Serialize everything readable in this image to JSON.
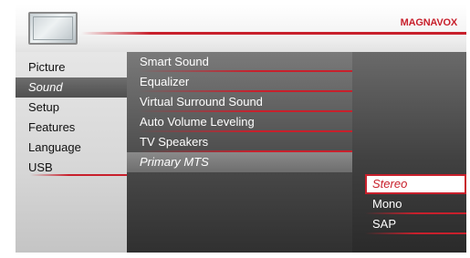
{
  "header": {
    "brand": "MAGNAVOX",
    "icon": "tv-icon"
  },
  "menu": {
    "main_items": [
      {
        "label": "Picture",
        "selected": false
      },
      {
        "label": "Sound",
        "selected": true
      },
      {
        "label": "Setup",
        "selected": false
      },
      {
        "label": "Features",
        "selected": false
      },
      {
        "label": "Language",
        "selected": false
      },
      {
        "label": "USB",
        "selected": false
      }
    ],
    "sound_items": [
      {
        "label": "Smart Sound",
        "selected": false
      },
      {
        "label": "Equalizer",
        "selected": false
      },
      {
        "label": "Virtual Surround Sound",
        "selected": false
      },
      {
        "label": "Auto Volume Leveling",
        "selected": false
      },
      {
        "label": "TV Speakers",
        "selected": false
      },
      {
        "label": "Primary MTS",
        "selected": true
      }
    ],
    "mts_options": [
      {
        "label": "Stereo",
        "selected": true
      },
      {
        "label": "Mono",
        "selected": false
      },
      {
        "label": "SAP",
        "selected": false
      }
    ]
  },
  "colors": {
    "accent": "#c8202c",
    "active_text": "#ffffff"
  }
}
